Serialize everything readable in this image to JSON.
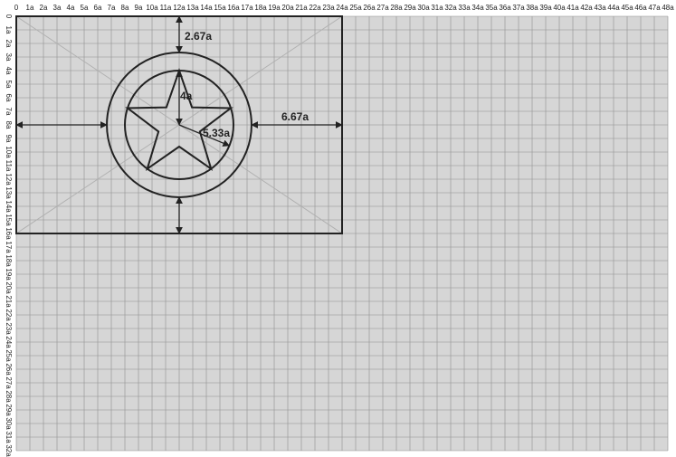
{
  "grid": {
    "columns": 48,
    "rows": 32,
    "background_color": "#d6d6d6",
    "line_color": "#8f8f8f",
    "top_tick_labels": [
      "0",
      "1a",
      "2a",
      "3a",
      "4a",
      "5a",
      "6a",
      "7a",
      "8a",
      "9a",
      "10a",
      "11a",
      "12a",
      "13a",
      "14a",
      "15a",
      "16a",
      "17a",
      "18a",
      "19a",
      "20a",
      "21a",
      "22a",
      "23a",
      "24a",
      "25a",
      "26a",
      "27a",
      "28a",
      "29a",
      "30a",
      "31a",
      "32a",
      "33a",
      "34a",
      "35a",
      "36a",
      "37a",
      "38a",
      "39a",
      "40a",
      "41a",
      "42a",
      "43a",
      "44a",
      "45a",
      "46a",
      "47a",
      "48a"
    ],
    "left_tick_labels": [
      "0",
      "1a",
      "2a",
      "3a",
      "4a",
      "5a",
      "6a",
      "7a",
      "8a",
      "9a",
      "10a",
      "11a",
      "12a",
      "13a",
      "14a",
      "15a",
      "16a",
      "17a",
      "18a",
      "19a",
      "20a",
      "21a",
      "22a",
      "23a",
      "24a",
      "25a",
      "26a",
      "27a",
      "28a",
      "29a",
      "30a",
      "31a",
      "32a"
    ]
  },
  "flag": {
    "x_range": [
      0,
      24
    ],
    "y_range": [
      0,
      16
    ],
    "outline_color": "#222222",
    "diagonal_color": "#b0b0b0",
    "emblem_center": [
      12,
      8
    ],
    "outer_circle_radius": 5.33,
    "inner_circle_radius": 4,
    "star_outer_radius": 4,
    "star_inner_radius": 1.6
  },
  "dimensions": {
    "top_gap": "2.67a",
    "star_radius": "4a",
    "outer_radius": "5.33a",
    "side_gap": "6.67a"
  }
}
